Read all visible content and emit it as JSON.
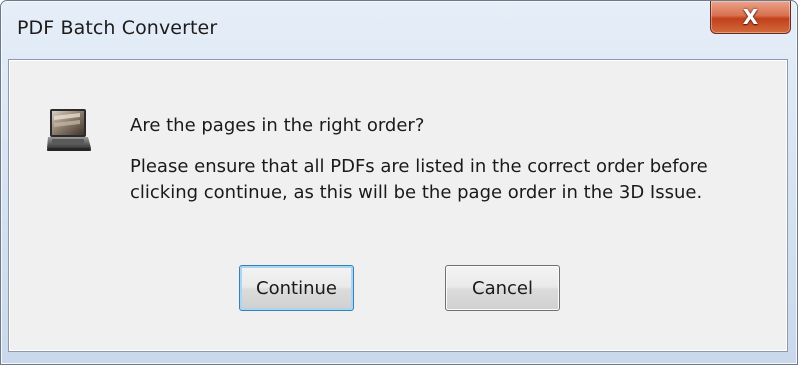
{
  "window": {
    "title": "PDF Batch Converter",
    "close_glyph": "X"
  },
  "dialog": {
    "icon": "laptop-icon",
    "heading": "Are the pages in the right order?",
    "message": "Please ensure that all PDFs are listed in the correct order before clicking continue, as this will be the page order in the 3D Issue.",
    "buttons": {
      "continue_label": "Continue",
      "cancel_label": "Cancel"
    }
  },
  "colors": {
    "close_button": "#c2401b",
    "dialog_background": "#f0f0f0",
    "default_button_border": "#3c7fb1"
  }
}
